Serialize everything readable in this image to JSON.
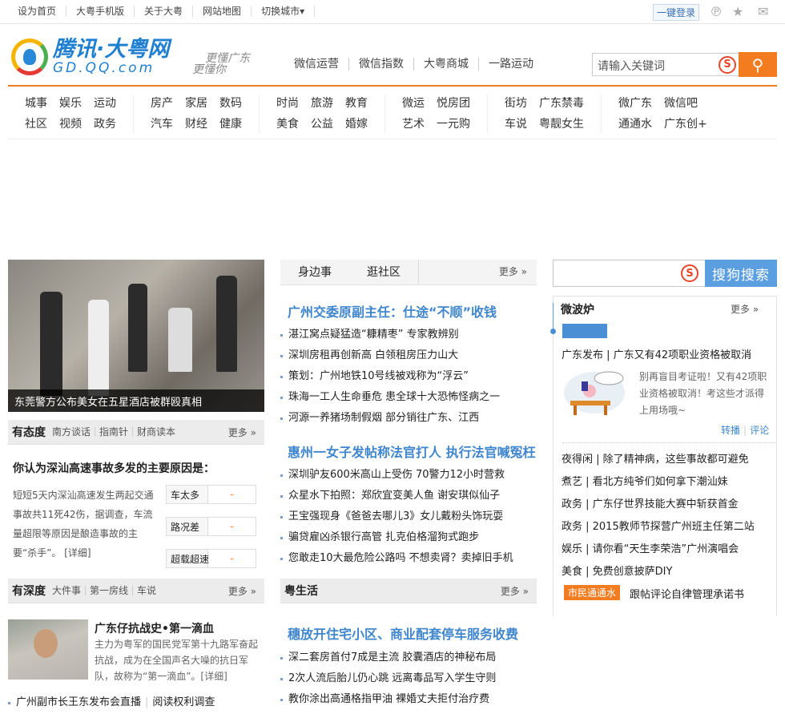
{
  "topbar": {
    "links": [
      "设为首页",
      "大粤手机版",
      "关于大粤",
      "网站地图",
      "切换城市▾"
    ],
    "login": "一键登录"
  },
  "header": {
    "logo_cn": "腾讯·大粤网",
    "logo_en": "GD.QQ.com",
    "slogan1": "更懂广东",
    "slogan2": "更懂你",
    "links": [
      "微信运营",
      "微信指数",
      "大粤商城",
      "一路运动"
    ],
    "search_placeholder": "请输入关键词"
  },
  "nav": [
    [
      "城事",
      "娱乐",
      "运动",
      "社区",
      "视频",
      "政务"
    ],
    [
      "房产",
      "家居",
      "数码",
      "汽车",
      "财经",
      "健康"
    ],
    [
      "时尚",
      "旅游",
      "教育",
      "美食",
      "公益",
      "婚嫁"
    ],
    [
      "微运",
      "悦房团",
      "艺术",
      "一元购"
    ],
    [
      "街坊",
      "广东禁毒",
      "车说",
      "粤靓女生"
    ],
    [
      "微广东",
      "微信吧",
      "通通水",
      "广东创+"
    ]
  ],
  "left": {
    "photo_caption": "东莞警方公布美女在五星酒店被群殴真相",
    "attitude": {
      "title": "有态度",
      "subs": [
        "南方谈话",
        "指南针",
        "财商读本"
      ],
      "more": "更多 »",
      "question": "你认为深汕高速事故多发的主要原因是：",
      "desc": "短短5天内深汕高速发生两起交通事故共11死42伤，据调查，车流量超限等原因是酿造事故的主要“杀手”。 [详细]",
      "options": [
        {
          "label": "车太多",
          "value": "-"
        },
        {
          "label": "路况差",
          "value": "-"
        },
        {
          "label": "超载超速",
          "value": "-"
        }
      ]
    },
    "depth": {
      "title": "有深度",
      "subs": [
        "大件事",
        "第一房线",
        "车说"
      ],
      "more": "更多 »",
      "story_title": "广东仔抗战史•第一滴血",
      "story_desc": "主力为粤军的国民党军第十九路军奋起抗战，成为在全国声名大噪的抗日军队，故称为“第一滴血”。[详细]",
      "link1": "广州副市长王东发布会直播",
      "link2": "阅读权利调查"
    }
  },
  "middle": {
    "tabs": [
      "身边事",
      "逛社区"
    ],
    "more": "更多 »",
    "headline1": "广州交委原副主任：仕途“不顺”收钱",
    "list1": [
      "湛江窝点疑猛造“糠精枣” 专家教辨别",
      "深圳房租再创新高 白领租房压力山大",
      "策划：广州地铁10号线被戏称为“浮云”",
      "珠海一工人生命垂危 患全球十大恐怖怪病之一",
      "河源一养猪场制假烟 部分销往广东、江西"
    ],
    "headline2": "惠州一女子发帖称法官打人 执行法官喊冤枉",
    "list2": [
      "深圳驴友600米高山上受伤 70警力12小时营救",
      "众星水下拍照：郑欣宜变美人鱼 谢安琪似仙子",
      "王宝强现身《爸爸去哪儿3》女儿戴粉头饰玩耍",
      "骗贷雇凶杀银行高管 扎克伯格溜狗式跑步",
      "您敢走10大最危险公路吗 不想卖肾？卖掉旧手机"
    ],
    "life": {
      "title": "粤生活",
      "more": "更多 »",
      "headline": "穗放开住宅小区、商业配套停车服务收费",
      "list": [
        "深二套房首付7成是主流 胶囊酒店的神秘布局",
        "2次人流后胎儿仍心跳 远离毒品写入学生守则",
        "教你涂出高通格指甲油 裸婚丈夫拒付治疗费"
      ]
    }
  },
  "right": {
    "search_button": "搜狗搜索",
    "weibo": {
      "title": "微波炉",
      "more": "更多 »",
      "feature": "广东发布 | 广东又有42项职业资格被取消",
      "desc": "别再盲目考证啦！又有42项职业资格被取消！考这些才派得上用场哦~",
      "repost": "转播",
      "comment": "评论",
      "list": [
        "夜得闲 | 除了精神病，这些事故都可避免",
        "煮艺 | 看北方纯爷们如何拿下潮汕妹",
        "政务 | 广东仔世界技能大赛中斩获首金",
        "政务 | 2015教师节探营广州班主任第二站",
        "娱乐 | 请你看“天生李荣浩”广州演唱会",
        "美食 | 免费创意披萨DIY"
      ],
      "tag": "市民通通水",
      "tag_text": "跟帖评论自律管理承诺书"
    }
  },
  "colors": {
    "accent": "#f47c20",
    "link_blue": "#3f86cc",
    "sogou_blue": "#5b9fe0"
  }
}
